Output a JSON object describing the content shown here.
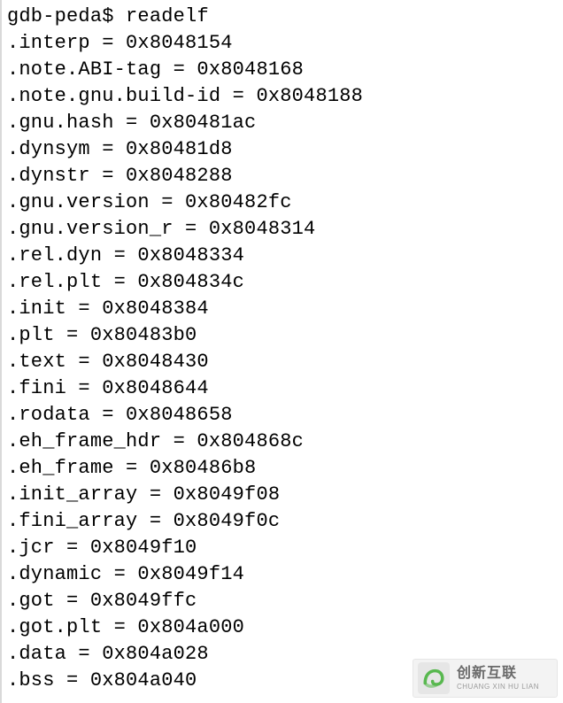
{
  "prompt": "gdb-peda$ ",
  "command": "readelf",
  "sections": [
    {
      "name": ".interp",
      "addr": "0x8048154"
    },
    {
      "name": ".note.ABI-tag",
      "addr": "0x8048168"
    },
    {
      "name": ".note.gnu.build-id",
      "addr": "0x8048188"
    },
    {
      "name": ".gnu.hash",
      "addr": "0x80481ac"
    },
    {
      "name": ".dynsym",
      "addr": "0x80481d8"
    },
    {
      "name": ".dynstr",
      "addr": "0x8048288"
    },
    {
      "name": ".gnu.version",
      "addr": "0x80482fc"
    },
    {
      "name": ".gnu.version_r",
      "addr": "0x8048314"
    },
    {
      "name": ".rel.dyn",
      "addr": "0x8048334"
    },
    {
      "name": ".rel.plt",
      "addr": "0x804834c"
    },
    {
      "name": ".init",
      "addr": "0x8048384"
    },
    {
      "name": ".plt",
      "addr": "0x80483b0"
    },
    {
      "name": ".text",
      "addr": "0x8048430"
    },
    {
      "name": ".fini",
      "addr": "0x8048644"
    },
    {
      "name": ".rodata",
      "addr": "0x8048658"
    },
    {
      "name": ".eh_frame_hdr",
      "addr": "0x804868c"
    },
    {
      "name": ".eh_frame",
      "addr": "0x80486b8"
    },
    {
      "name": ".init_array",
      "addr": "0x8049f08"
    },
    {
      "name": ".fini_array",
      "addr": "0x8049f0c"
    },
    {
      "name": ".jcr",
      "addr": "0x8049f10"
    },
    {
      "name": ".dynamic",
      "addr": "0x8049f14"
    },
    {
      "name": ".got",
      "addr": "0x8049ffc"
    },
    {
      "name": ".got.plt",
      "addr": "0x804a000"
    },
    {
      "name": ".data",
      "addr": "0x804a028"
    },
    {
      "name": ".bss",
      "addr": "0x804a040"
    }
  ],
  "watermark": {
    "zh": "创新互联",
    "pinyin": "CHUANG XIN HU LIAN"
  }
}
